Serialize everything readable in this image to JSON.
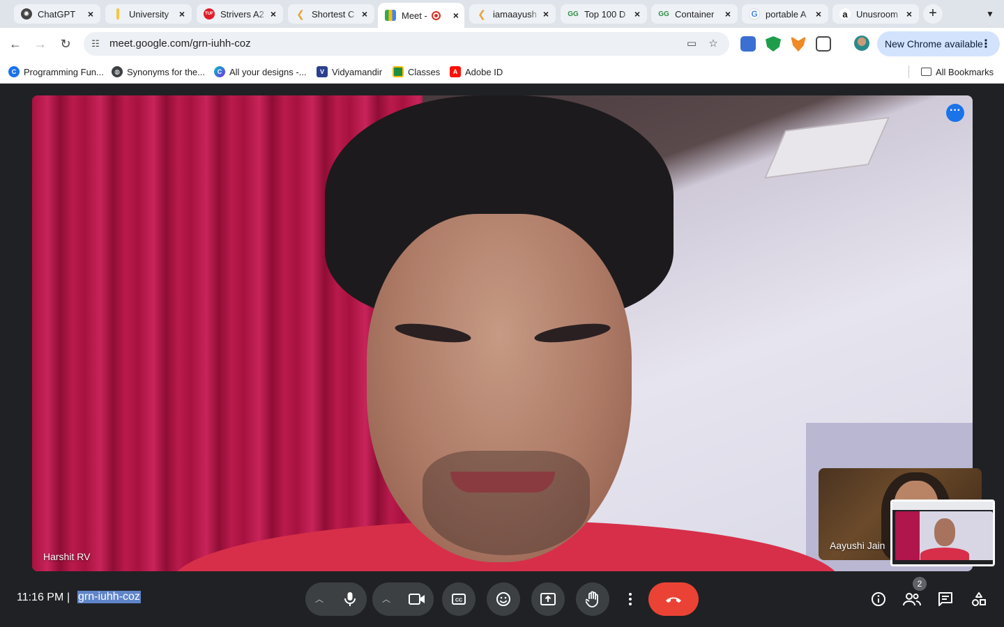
{
  "browser": {
    "tabs": [
      {
        "title": "ChatGPT",
        "favicon": "chatgpt-icon"
      },
      {
        "title": "University",
        "favicon": "university-icon"
      },
      {
        "title": "Strivers A2",
        "favicon": "tuf-icon"
      },
      {
        "title": "Shortest C",
        "favicon": "codestudio-icon"
      },
      {
        "title": "Meet -",
        "favicon": "google-meet-icon",
        "recording": true,
        "active": true
      },
      {
        "title": "iamaayush",
        "favicon": "codestudio-icon"
      },
      {
        "title": "Top 100 D",
        "favicon": "gfg-icon"
      },
      {
        "title": "Container",
        "favicon": "gfg-icon"
      },
      {
        "title": "portable A",
        "favicon": "google-icon"
      },
      {
        "title": "Unusroom",
        "favicon": "amazon-icon"
      }
    ],
    "url": "meet.google.com/grn-iuhh-coz",
    "update_button": "New Chrome available",
    "bookmarks": [
      {
        "label": "Programming Fun...",
        "icon": "c-logo-icon"
      },
      {
        "label": "Synonyms for the...",
        "icon": "globe-icon"
      },
      {
        "label": "All your designs -...",
        "icon": "canva-icon"
      },
      {
        "label": "Vidyamandir",
        "icon": "vidyamandir-icon"
      },
      {
        "label": "Classes",
        "icon": "google-classroom-icon"
      },
      {
        "label": "Adobe ID",
        "icon": "adobe-icon"
      }
    ],
    "all_bookmarks": "All Bookmarks"
  },
  "meet": {
    "main_participant": "Harshit RV",
    "tile_participant": "Aayushi Jain",
    "clock": "11:16 PM",
    "separator": "|",
    "meeting_code": "grn-iuhh-coz",
    "people_count": "2"
  },
  "colors": {
    "end_call": "#ea4335",
    "control_bg": "#3c4043",
    "meet_bg": "#202124",
    "accent_blue": "#1a73e8"
  }
}
